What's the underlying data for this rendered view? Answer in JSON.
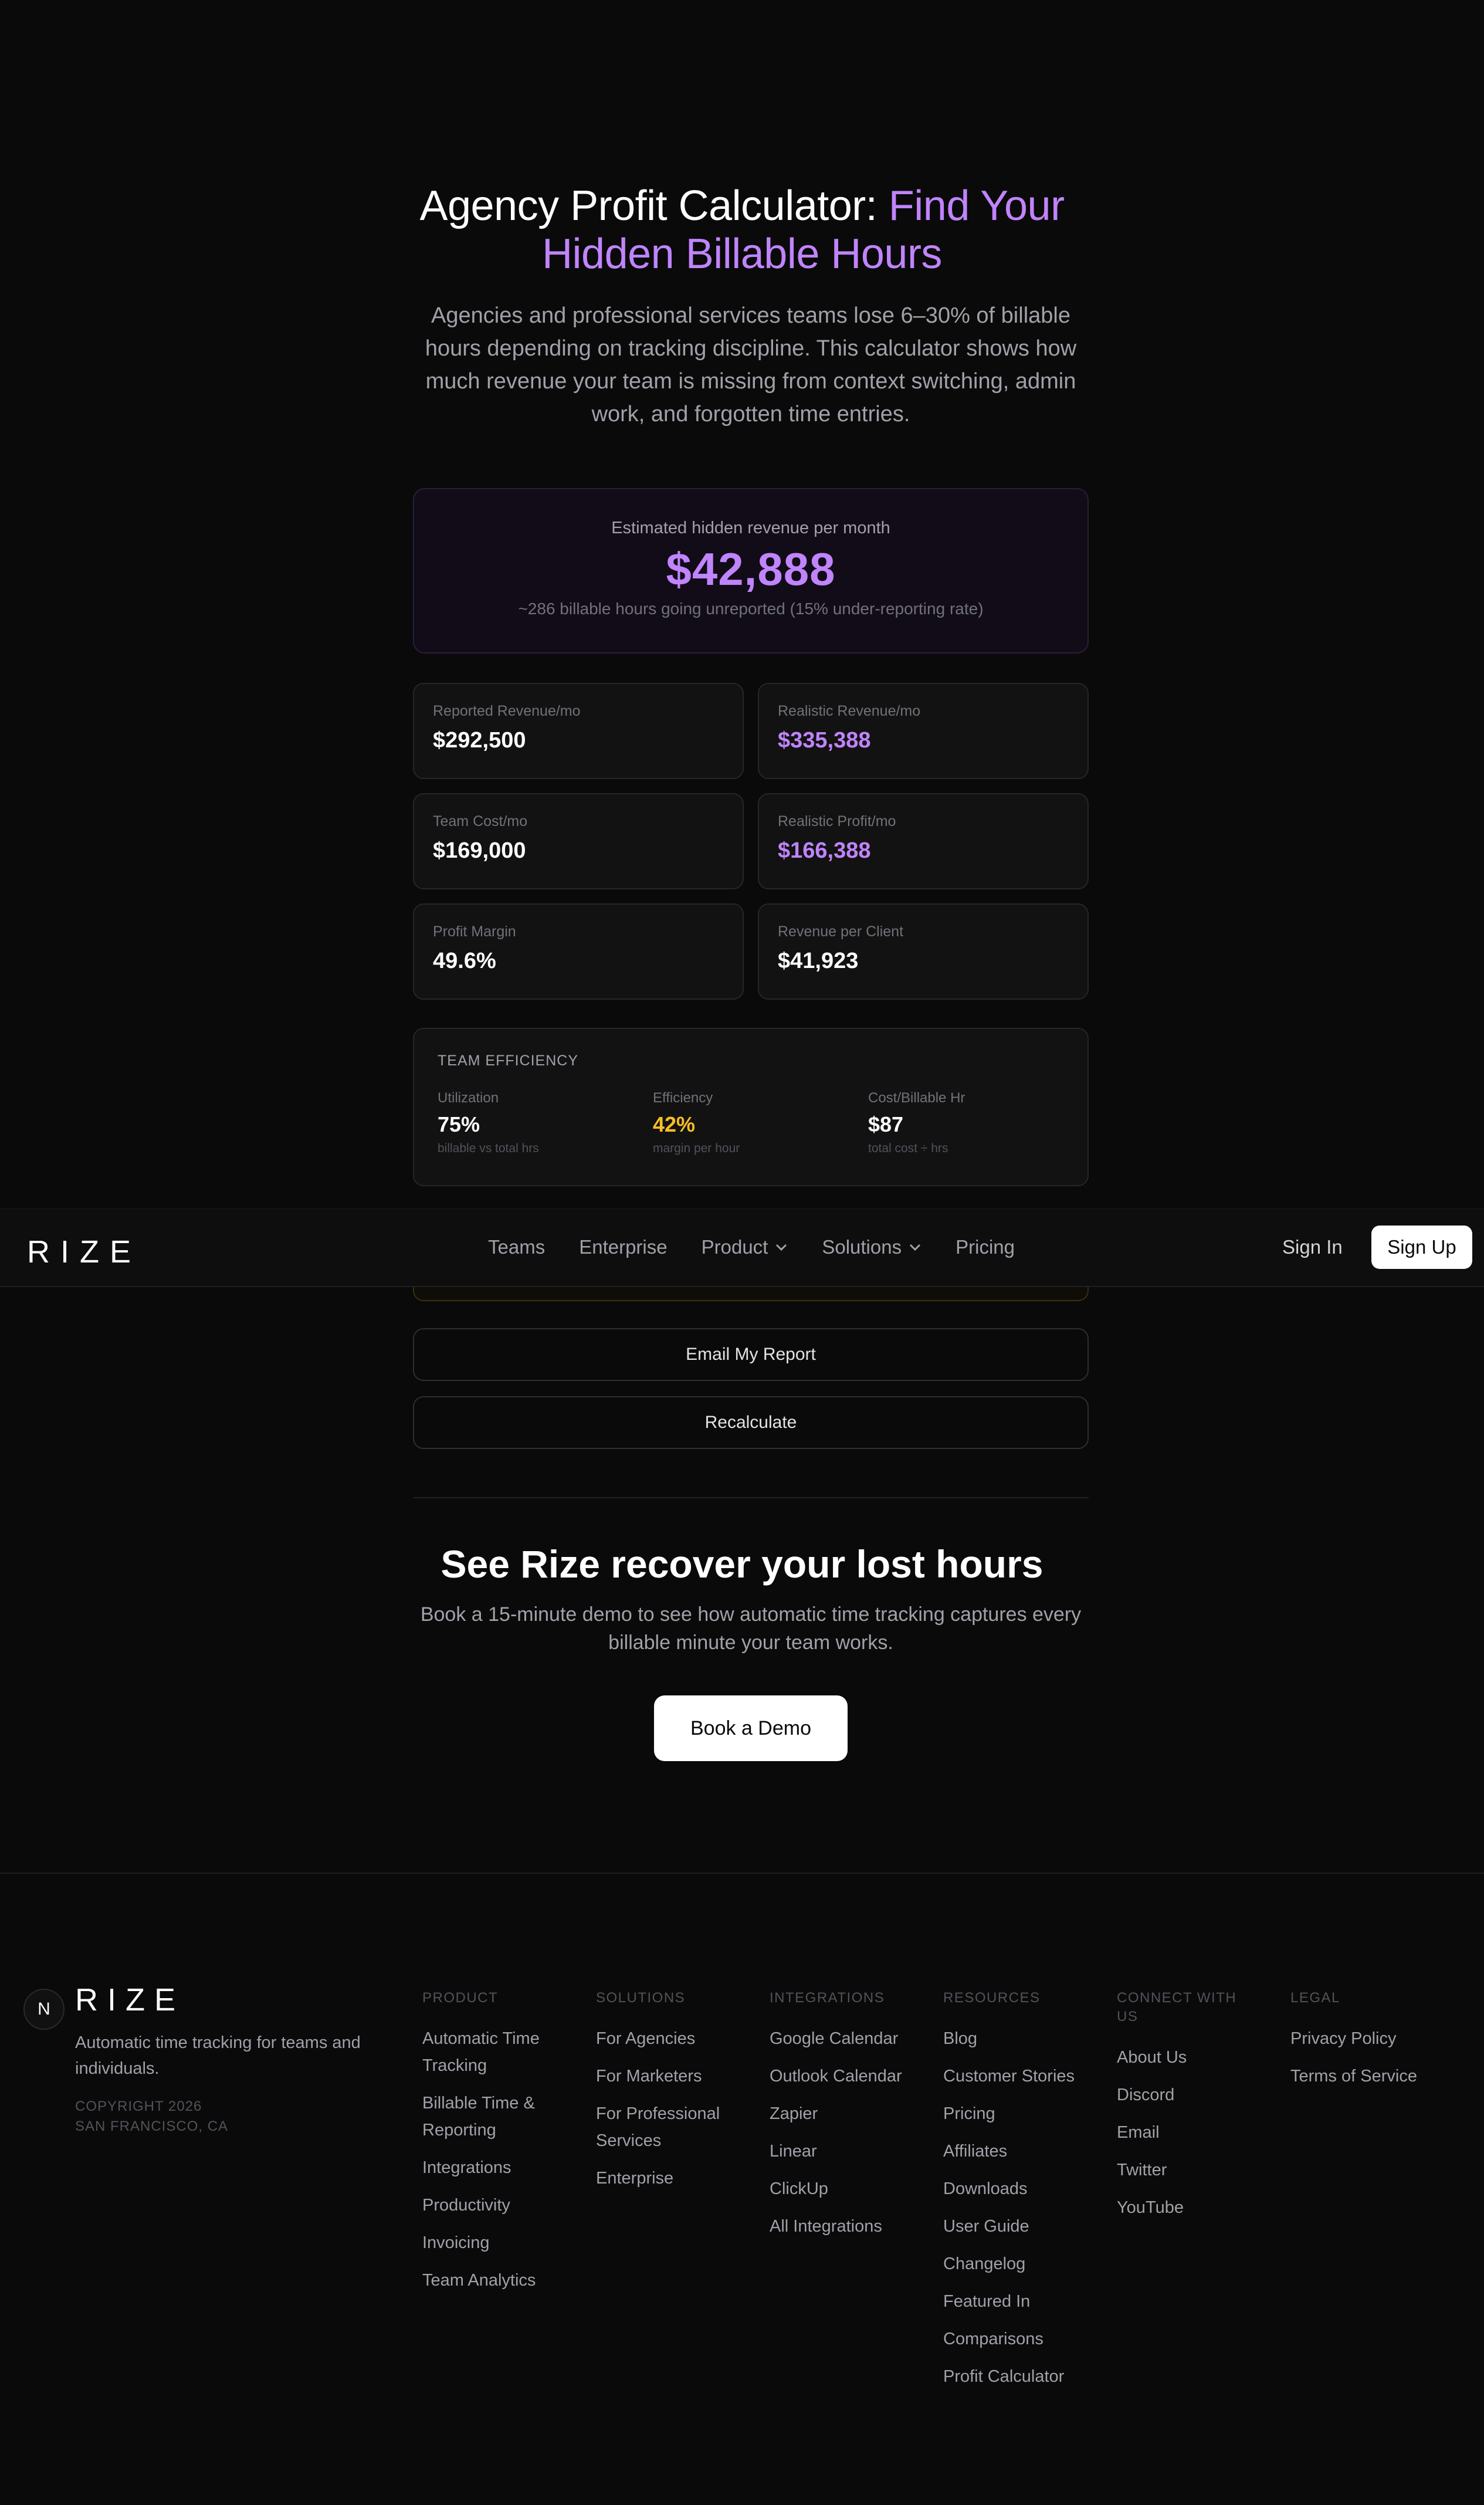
{
  "hero": {
    "title_part1": "Agency Profit Calculator: ",
    "title_accent_line1": "Find Your",
    "title_accent_line2": "Hidden Billable Hours",
    "subtitle": "Agencies and professional services teams lose 6–30% of billable hours depending on tracking discipline. This calculator shows how much revenue your team is missing from context switching, admin work, and forgotten time entries."
  },
  "highlight": {
    "label": "Estimated hidden revenue per month",
    "value": "$42,888",
    "note": "~286 billable hours going unreported (15% under-reporting rate)"
  },
  "stats": [
    {
      "label": "Reported Revenue/mo",
      "value": "$292,500"
    },
    {
      "label": "Realistic Revenue/mo",
      "value": "$335,388"
    },
    {
      "label": "Team Cost/mo",
      "value": "$169,000"
    },
    {
      "label": "Realistic Profit/mo",
      "value": "$166,388"
    },
    {
      "label": "Profit Margin",
      "value": "49.6%"
    },
    {
      "label": "Revenue per Client",
      "value": "$41,923"
    }
  ],
  "efficiency": {
    "title": "TEAM EFFICIENCY",
    "cols": [
      {
        "label": "Utilization",
        "value": "75%",
        "sub": "billable vs total hrs"
      },
      {
        "label": "Efficiency",
        "value": "42%",
        "sub": "margin per hour"
      },
      {
        "label": "Cost/Billable Hr",
        "value": "$87",
        "sub": "total cost ÷ hrs"
      }
    ]
  },
  "nav": {
    "logo": "RIZE",
    "links": [
      "Teams",
      "Enterprise",
      "Product",
      "Solutions",
      "Pricing"
    ],
    "signin": "Sign In",
    "signup": "Sign Up"
  },
  "buttons": {
    "email_report": "Email My Report",
    "recalculate": "Recalculate"
  },
  "cta": {
    "title": "See Rize recover your lost hours",
    "subtitle": "Book a 15-minute demo to see how automatic time tracking captures every billable minute your team works.",
    "button": "Book a Demo"
  },
  "footer": {
    "badge": "N",
    "logo": "RIZE",
    "tagline": "Automatic time tracking for teams and individuals.",
    "copyright": "COPYRIGHT 2026",
    "location": "SAN FRANCISCO, CA",
    "columns": [
      {
        "head": "PRODUCT",
        "items": [
          "Automatic Time Tracking",
          "Billable Time & Reporting",
          "Integrations",
          "Productivity",
          "Invoicing",
          "Team Analytics"
        ]
      },
      {
        "head": "SOLUTIONS",
        "items": [
          "For Agencies",
          "For Marketers",
          "For Professional Services",
          "Enterprise"
        ]
      },
      {
        "head": "INTEGRATIONS",
        "items": [
          "Google Calendar",
          "Outlook Calendar",
          "Zapier",
          "Linear",
          "ClickUp",
          "All Integrations"
        ]
      },
      {
        "head": "RESOURCES",
        "items": [
          "Blog",
          "Customer Stories",
          "Pricing",
          "Affiliates",
          "Downloads",
          "User Guide",
          "Changelog",
          "Featured In",
          "Comparisons",
          "Profit Calculator"
        ]
      },
      {
        "head": "CONNECT WITH US",
        "items": [
          "About Us",
          "Discord",
          "Email",
          "Twitter",
          "YouTube"
        ]
      },
      {
        "head": "LEGAL",
        "items": [
          "Privacy Policy",
          "Terms of Service"
        ]
      }
    ]
  },
  "colors": {
    "accent_purple": "#c084fc",
    "accent_yellow": "#fbbf24",
    "background": "#0a0a0a"
  }
}
